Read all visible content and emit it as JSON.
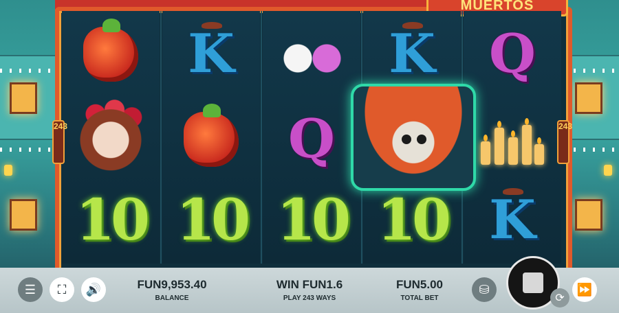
{
  "game": {
    "logo_text": "MUERTOS",
    "ways_left": "243",
    "ways_right": "243"
  },
  "reels": [
    [
      "peppers",
      "catrina",
      "ten"
    ],
    [
      "k",
      "peppers",
      "ten"
    ],
    [
      "sugar-skulls",
      "q",
      "ten"
    ],
    [
      "k",
      "mariachi-skeleton",
      "ten"
    ],
    [
      "q",
      "candles",
      "k"
    ]
  ],
  "symbols": {
    "k": "K",
    "q": "Q",
    "ten": "10"
  },
  "controls": {
    "menu_icon": "☰",
    "fullscreen_icon": "⛶",
    "sound_icon": "🔊",
    "coins_icon": "⛁",
    "fast_forward_icon": "⏩",
    "autoplay_icon": "⟳"
  },
  "balance": {
    "value": "FUN9,953.40",
    "label": "BALANCE"
  },
  "win": {
    "value": "WIN FUN1.6",
    "label": "PLAY 243 WAYS"
  },
  "total_bet": {
    "value": "FUN5.00",
    "label": "TOTAL BET"
  },
  "colors": {
    "frame": "#e05a2b",
    "frame_trim": "#f2a13a",
    "k_symbol": "#2f9fd8",
    "q_symbol": "#c84fc8",
    "ten_symbol": "#b6e64a",
    "bottom_bar": "#cdd8da"
  }
}
